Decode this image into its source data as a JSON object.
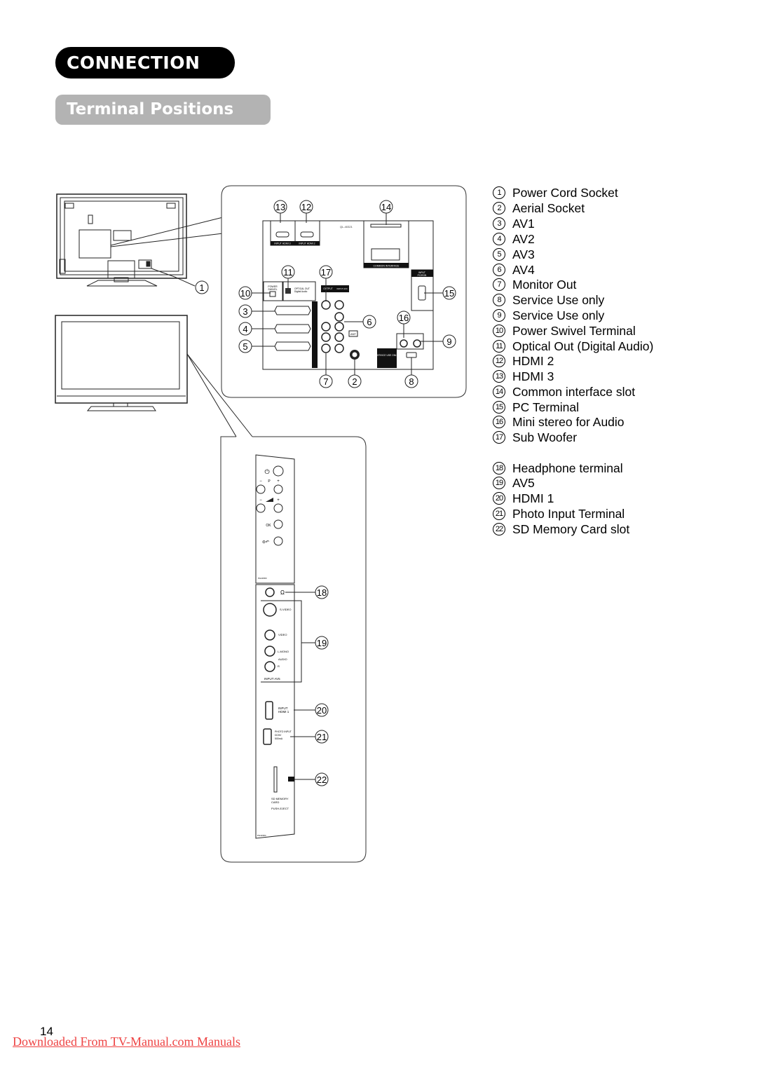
{
  "header": {
    "section_title": "CONNECTION",
    "subsection_title": "Terminal Positions"
  },
  "legend": {
    "items": [
      {
        "num": "1",
        "label": "Power Cord Socket"
      },
      {
        "num": "2",
        "label": "Aerial Socket"
      },
      {
        "num": "3",
        "label": "AV1"
      },
      {
        "num": "4",
        "label": "AV2"
      },
      {
        "num": "5",
        "label": "AV3"
      },
      {
        "num": "6",
        "label": "AV4"
      },
      {
        "num": "7",
        "label": "Monitor Out"
      },
      {
        "num": "8",
        "label": "Service Use only"
      },
      {
        "num": "9",
        "label": "Service Use only"
      },
      {
        "num": "10",
        "label": "Power Swivel Terminal"
      },
      {
        "num": "11",
        "label": "Optical Out (Digital Audio)"
      },
      {
        "num": "12",
        "label": "HDMI 2"
      },
      {
        "num": "13",
        "label": "HDMI 3"
      },
      {
        "num": "14",
        "label": "Common interface slot"
      },
      {
        "num": "15",
        "label": "PC Terminal"
      },
      {
        "num": "16",
        "label": "Mini stereo for Audio"
      },
      {
        "num": "17",
        "label": "Sub Woofer"
      },
      {
        "num": "18",
        "label": "Headphone terminal"
      },
      {
        "num": "19",
        "label": "AV5"
      },
      {
        "num": "20",
        "label": "HDMI 1"
      },
      {
        "num": "21",
        "label": "Photo Input Terminal"
      },
      {
        "num": "22",
        "label": "SD Memory Card slot"
      }
    ]
  },
  "back_panel": {
    "hdmi3_label": "INPUT HDMI 3",
    "hdmi2_label": "INPUT HDMI 2",
    "model_code": "QL-40321",
    "ci_label": "COMMON INTERFACE",
    "pc_label_1": "INPUT",
    "pc_label_2": "PC/RGB",
    "swivel_label_1": "POWER",
    "swivel_label_2": "SWIVEL",
    "optical_label_1": "OPTICAL OUT",
    "optical_label_2": "Digital Audio",
    "output_label": "OUTPUT",
    "input_av4_label": "INPUT AV4",
    "ant_label": "ANT",
    "service_label": "SERVICE USE ONLY",
    "callouts": [
      "13",
      "12",
      "14",
      "11",
      "17",
      "10",
      "15",
      "3",
      "4",
      "5",
      "6",
      "16",
      "9",
      "7",
      "2",
      "8"
    ]
  },
  "side_panel": {
    "channel_label": "P",
    "ok_label": "OK",
    "panel_code_top": "PH41583",
    "svideo_label": "S-VIDEO",
    "video_label": "VIDEO",
    "lmono_label": "L-MONO",
    "audio_label": "AUDIO",
    "r_label": "R",
    "input_av5_label": "INPUT  AV5",
    "hdmi1_label_1": "INPUT",
    "hdmi1_label_2": "HDMI  1",
    "photo_label_1": "PHOTO INPUT",
    "photo_label_2": "DC5V",
    "photo_label_3": "500mA",
    "sd_label_1": "SD MEMORY",
    "sd_label_2": "CARD",
    "sd_label_3": "PUSH-EJECT",
    "panel_code_bottom": "PH41584",
    "callouts": [
      "18",
      "19",
      "20",
      "21",
      "22"
    ]
  },
  "tv_back": {
    "callout": "1"
  },
  "footer": {
    "page_number": "14",
    "source_link": "Downloaded From TV-Manual.com Manuals"
  }
}
